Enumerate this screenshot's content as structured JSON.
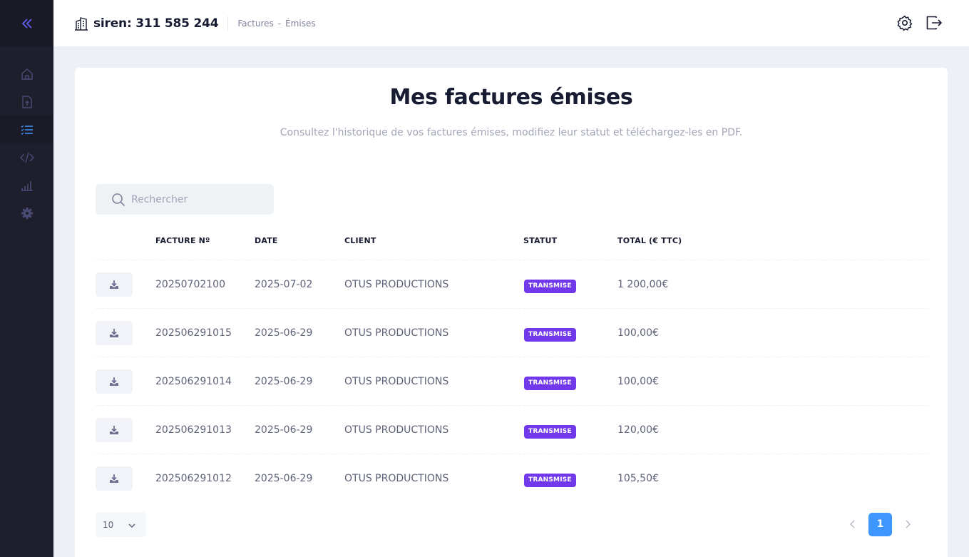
{
  "header": {
    "title": "siren: 311 585 244",
    "breadcrumb": [
      "Factures",
      "-",
      "Émises"
    ]
  },
  "page": {
    "title": "Mes factures émises",
    "subtitle": "Consultez l'historique de vos factures émises, modifiez leur statut et téléchargez-les en PDF."
  },
  "search": {
    "placeholder": "Rechercher"
  },
  "table": {
    "columns": [
      "FACTURE Nº",
      "DATE",
      "CLIENT",
      "STATUT",
      "TOTAL (€ TTC)"
    ],
    "rows": [
      {
        "number": "20250702100",
        "date": "2025-07-02",
        "client": "OTUS PRODUCTIONS",
        "status": "TRANSMISE",
        "total": "1 200,00€"
      },
      {
        "number": "202506291015",
        "date": "2025-06-29",
        "client": "OTUS PRODUCTIONS",
        "status": "TRANSMISE",
        "total": "100,00€"
      },
      {
        "number": "202506291014",
        "date": "2025-06-29",
        "client": "OTUS PRODUCTIONS",
        "status": "TRANSMISE",
        "total": "100,00€"
      },
      {
        "number": "202506291013",
        "date": "2025-06-29",
        "client": "OTUS PRODUCTIONS",
        "status": "TRANSMISE",
        "total": "120,00€"
      },
      {
        "number": "202506291012",
        "date": "2025-06-29",
        "client": "OTUS PRODUCTIONS",
        "status": "TRANSMISE",
        "total": "105,50€"
      }
    ]
  },
  "pagination": {
    "page_size": "10",
    "current_page": "1"
  },
  "sidebar": {
    "items": [
      {
        "icon": "home-icon"
      },
      {
        "icon": "file-upload-icon"
      },
      {
        "icon": "list-icon",
        "active": true
      },
      {
        "icon": "code-icon"
      },
      {
        "icon": "bar-chart-icon"
      },
      {
        "icon": "gear-icon"
      }
    ]
  },
  "colors": {
    "sidebar_bg": "#1e1e2d",
    "accent": "#3e97ff",
    "status_badge": "#7239ea",
    "page_bg": "#eef0f8"
  }
}
